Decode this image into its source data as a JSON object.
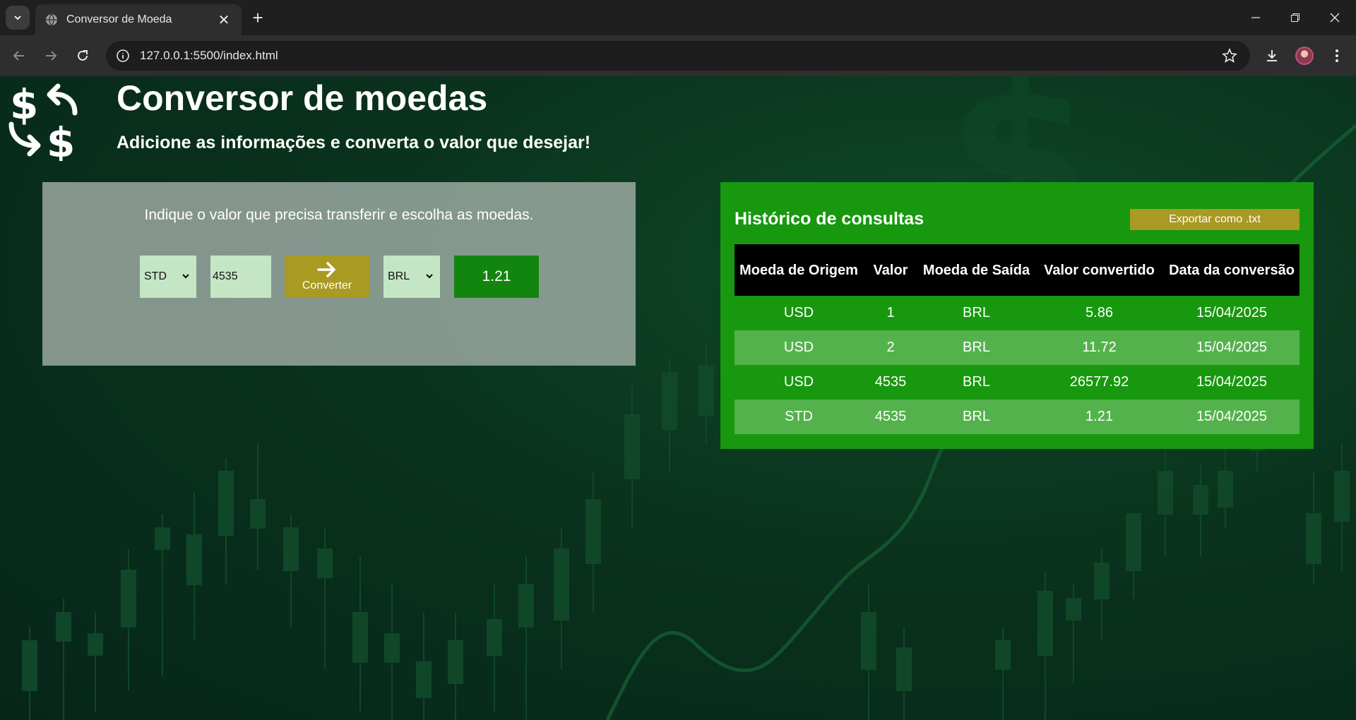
{
  "browser": {
    "tab_title": "Conversor de Moeda",
    "url": "127.0.0.1:5500/index.html"
  },
  "header": {
    "title": "Conversor de moedas",
    "subtitle": "Adicione as informações e converta o valor que desejar!"
  },
  "converter": {
    "instruction": "Indique o valor que precisa transferir e escolha as moedas.",
    "from_currency": "STD",
    "amount": "4535",
    "convert_label": "Converter",
    "to_currency": "BRL",
    "result": "1.21"
  },
  "history": {
    "title": "Histórico de consultas",
    "export_label": "Exportar como .txt",
    "columns": [
      "Moeda de Origem",
      "Valor",
      "Moeda de Saída",
      "Valor convertido",
      "Data da conversão"
    ],
    "rows": [
      [
        "USD",
        "1",
        "BRL",
        "5.86",
        "15/04/2025"
      ],
      [
        "USD",
        "2",
        "BRL",
        "11.72",
        "15/04/2025"
      ],
      [
        "USD",
        "4535",
        "BRL",
        "26577.92",
        "15/04/2025"
      ],
      [
        "STD",
        "4535",
        "BRL",
        "1.21",
        "15/04/2025"
      ]
    ]
  },
  "colors": {
    "converter_panel": "#b4beb9",
    "input_bg": "#c4e6c4",
    "button_gold": "#a89a22",
    "result_green": "#12850f",
    "history_panel": "#17980f",
    "table_header": "#000000"
  },
  "icons": [
    "tab-menu-icon",
    "globe-icon",
    "close-icon",
    "plus-icon",
    "minimize-icon",
    "restore-icon",
    "back-arrow-icon",
    "forward-arrow-icon",
    "reload-icon",
    "site-info-icon",
    "star-icon",
    "download-icon",
    "kebab-menu-icon",
    "currency-exchange-icon",
    "chevron-down-icon",
    "arrow-right-icon"
  ]
}
